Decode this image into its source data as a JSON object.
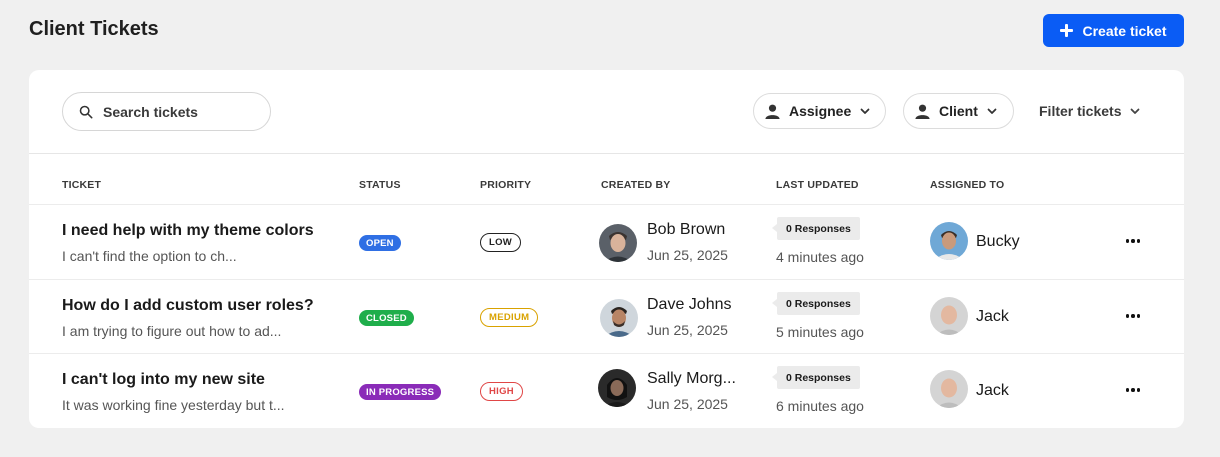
{
  "header": {
    "title": "Client Tickets",
    "create_label": "Create ticket",
    "accent": "#0a5cf5"
  },
  "toolbar": {
    "search_placeholder": "Search tickets",
    "assignee_label": "Assignee",
    "client_label": "Client",
    "filter_label": "Filter tickets"
  },
  "table": {
    "headers": [
      "TICKET",
      "STATUS",
      "PRIORITY",
      "CREATED BY",
      "LAST UPDATED",
      "ASSIGNED TO"
    ],
    "rows": [
      {
        "title": "I need help with my theme colors",
        "desc": "I can't find the option to ch...",
        "status": "OPEN",
        "status_color": "#2f6fe4",
        "priority": "LOW",
        "priority_color": "#222222",
        "creator": "Bob Brown",
        "created": "Jun 25, 2025",
        "responses": "0 Responses",
        "updated": "4 minutes ago",
        "assignee": "Bucky"
      },
      {
        "title": "How do I add custom user roles?",
        "desc": "I am trying to figure out how to ad...",
        "status": "CLOSED",
        "status_color": "#1fae4b",
        "priority": "MEDIUM",
        "priority_color": "#d9a200",
        "creator": "Dave Johns",
        "created": "Jun 25, 2025",
        "responses": "0 Responses",
        "updated": "5 minutes ago",
        "assignee": "Jack"
      },
      {
        "title": "I can't log into my new site",
        "desc": "It was working fine yesterday but t...",
        "status": "IN PROGRESS",
        "status_color": "#8a2bb8",
        "priority": "HIGH",
        "priority_color": "#e04646",
        "creator": "Sally Morg...",
        "created": "Jun 25, 2025",
        "responses": "0 Responses",
        "updated": "6 minutes ago",
        "assignee": "Jack"
      }
    ]
  }
}
